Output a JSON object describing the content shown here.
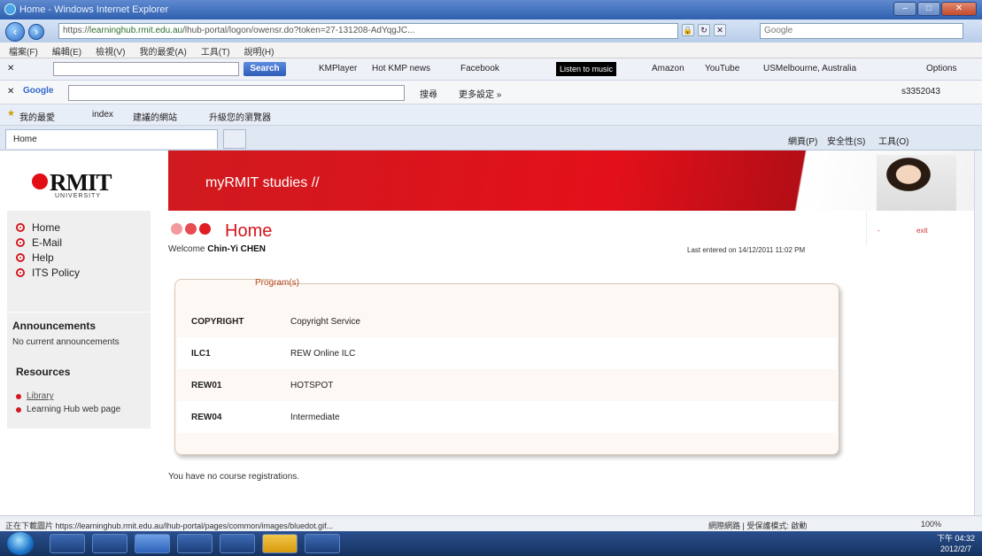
{
  "window": {
    "title": "Home - Windows Internet Explorer",
    "buttons": [
      "–",
      "□",
      "✕"
    ]
  },
  "address": {
    "url_prefix": "https://",
    "url_host": "learninghub.rmit.edu.au",
    "url_rest": "/lhub-portal/logon/owensr.do?token=27-131208-AdYqgJC...",
    "search_placeholder": "Google"
  },
  "menu": [
    "檔案(F)",
    "編輯(E)",
    "檢視(V)",
    "我的最愛(A)",
    "工具(T)",
    "說明(H)"
  ],
  "toolbar1": {
    "search_label": "Search",
    "items": [
      "KMPlayer",
      "Hot KMP news",
      "Facebook",
      "Amazon",
      "YouTube",
      "USMelbourne, Australia"
    ],
    "listen_label": "Listen to music",
    "options_label": "Options"
  },
  "toolbar2": {
    "google_label": "Google",
    "search_btn": "搜尋",
    "more": "更多設定 »",
    "user": "s3352043"
  },
  "toolbar3": {
    "items": [
      "我的最愛",
      "index",
      "建議的網站",
      "升級您的瀏覽器"
    ]
  },
  "tabs": {
    "active": "Home",
    "right_items": [
      "網頁(P)",
      "安全性(S)",
      "工具(O)"
    ]
  },
  "site": {
    "logo_text": "RMIT",
    "logo_sub": "UNIVERSITY",
    "banner": "myRMIT studies //"
  },
  "sidebar": {
    "nav": [
      "Home",
      "E-Mail",
      "Help",
      "ITS Policy"
    ],
    "announcements_title": "Announcements",
    "announcements_text": "No current announcements",
    "resources_title": "Resources",
    "resources": [
      "Library",
      "Learning Hub web page"
    ]
  },
  "main": {
    "title": "Home",
    "welcome_prefix": "Welcome",
    "user_name": "Chin-Yi CHEN",
    "last_entered": "Last entered on 14/12/2011 11:02 PM",
    "right_links": [
      "-",
      "exit"
    ],
    "programs_tab": "Program(s)",
    "programs": [
      {
        "code": "COPYRIGHT",
        "name": "Copyright Service"
      },
      {
        "code": "ILC1",
        "name": "REW Online ILC"
      },
      {
        "code": "REW01",
        "name": "HOTSPOT"
      },
      {
        "code": "REW04",
        "name": "Intermediate"
      }
    ],
    "no_course": "You have no course registrations."
  },
  "status": {
    "left": "正在下載圖片 https://learninghub.rmit.edu.au/lhub-portal/pages/common/images/bluedot.gif...",
    "zone": "網際網路 | 受保護模式: 啟動",
    "zoom": "100%"
  },
  "taskbar": {
    "time": "下午 04:32",
    "date": "2012/2/7"
  }
}
